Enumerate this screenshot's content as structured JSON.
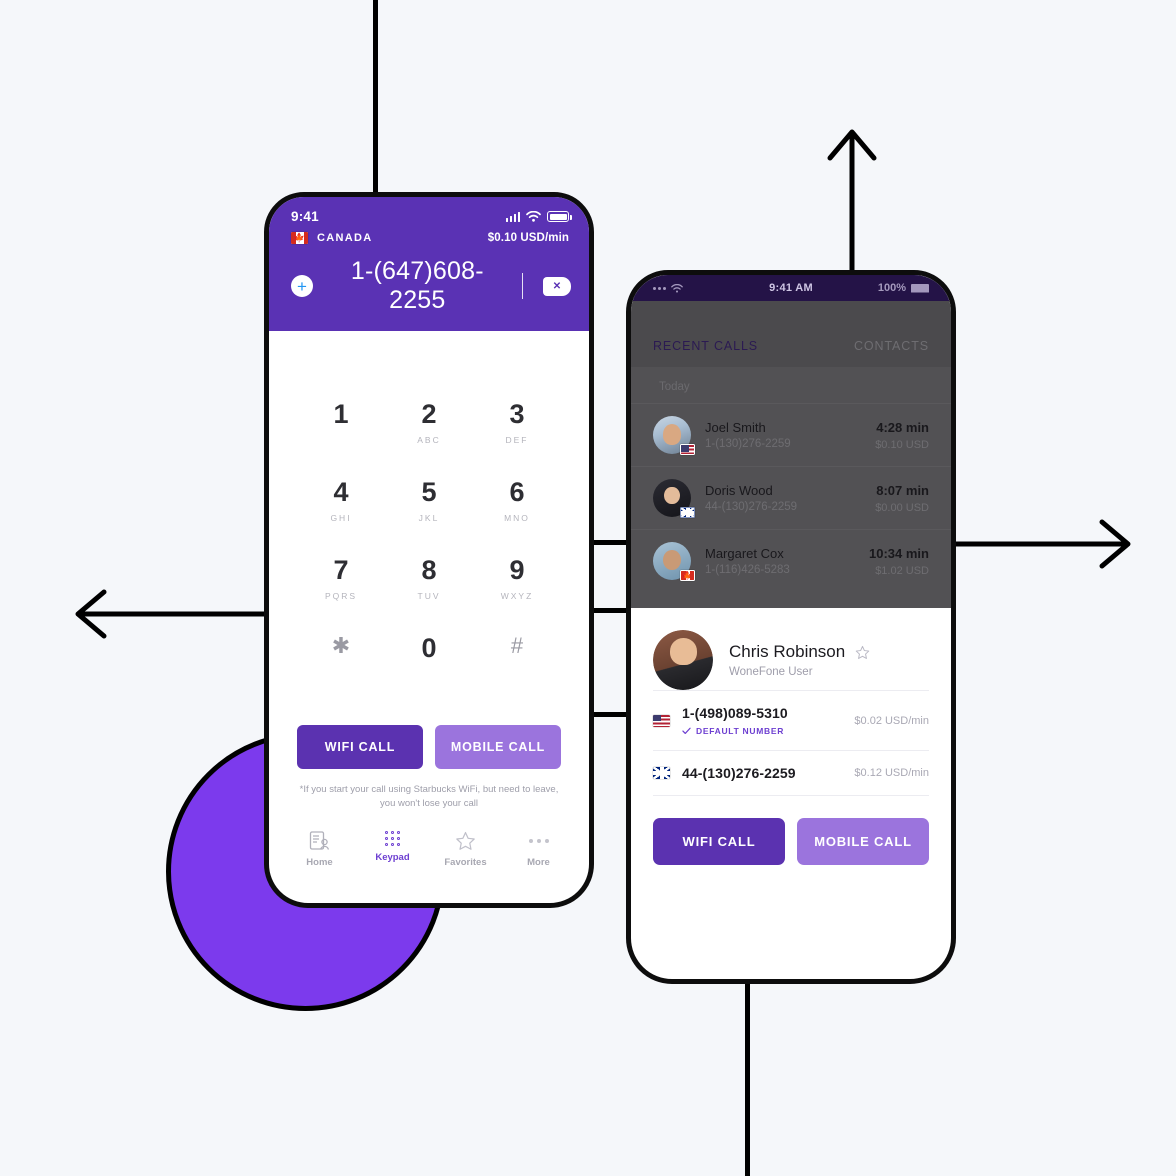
{
  "background_color": "#f5f7fa",
  "accent": {
    "primary": "#5a32b4",
    "secondary": "#9b74dd",
    "circle": "#7c3aed",
    "link": "#6d3fd1"
  },
  "phone1": {
    "status_bar": {
      "time": "9:41",
      "signal_icon": "signal-bars-icon",
      "wifi_icon": "wifi-icon",
      "battery_icon": "battery-icon"
    },
    "country_bar": {
      "flag_icon": "flag-canada-icon",
      "country": "CANADA",
      "rate": "$0.10 USD/min"
    },
    "dialer": {
      "add_icon": "plus-circle-icon",
      "number": "1-(647)608-2255",
      "delete_icon": "backspace-icon"
    },
    "keypad": [
      {
        "digit": "1",
        "letters": ""
      },
      {
        "digit": "2",
        "letters": "ABC"
      },
      {
        "digit": "3",
        "letters": "DEF"
      },
      {
        "digit": "4",
        "letters": "GHI"
      },
      {
        "digit": "5",
        "letters": "JKL"
      },
      {
        "digit": "6",
        "letters": "MNO"
      },
      {
        "digit": "7",
        "letters": "PQRS"
      },
      {
        "digit": "8",
        "letters": "TUV"
      },
      {
        "digit": "9",
        "letters": "WXYZ"
      },
      {
        "digit": "✱",
        "letters": ""
      },
      {
        "digit": "0",
        "letters": ""
      },
      {
        "digit": "#",
        "letters": ""
      }
    ],
    "wifi_call_label": "WIFI CALL",
    "mobile_call_label": "MOBILE CALL",
    "note": "*If you start your call using Starbucks WiFi, but need to leave, you won't lose your call",
    "tabs": [
      {
        "label": "Home",
        "icon": "contacts-list-icon",
        "active": false
      },
      {
        "label": "Keypad",
        "icon": "keypad-dots-icon",
        "active": true
      },
      {
        "label": "Favorites",
        "icon": "star-icon",
        "active": false
      },
      {
        "label": "More",
        "icon": "more-dots-icon",
        "active": false
      }
    ]
  },
  "phone2": {
    "status_bar": {
      "time": "9:41 AM",
      "battery": "100%",
      "signal_icon": "signal-dots-icon",
      "wifi_icon": "wifi-icon",
      "battery_icon": "battery-icon"
    },
    "tabs": {
      "recent": "RECENT CALLS",
      "contacts": "CONTACTS"
    },
    "section_label": "Today",
    "recent_calls": [
      {
        "name": "Joel Smith",
        "number": "1-(130)276-2259",
        "duration": "4:28 min",
        "cost": "$0.10 USD",
        "flag": "flag-us-icon",
        "avatar": "avatar-joel"
      },
      {
        "name": "Doris Wood",
        "number": "44-(130)276-2259",
        "duration": "8:07 min",
        "cost": "$0.00 USD",
        "flag": "flag-gb-icon",
        "avatar": "avatar-doris"
      },
      {
        "name": "Margaret Cox",
        "number": "1-(116)426-5283",
        "duration": "10:34 min",
        "cost": "$1.02 USD",
        "flag": "flag-ca-icon",
        "avatar": "avatar-margaret"
      }
    ],
    "contact": {
      "name": "Chris Robinson",
      "subtitle": "WoneFone User",
      "favorite_icon": "star-outline-icon",
      "avatar": "avatar-chris",
      "numbers": [
        {
          "number": "1-(498)089-5310",
          "rate": "$0.02 USD/min",
          "flag": "flag-us-icon",
          "default_label": "DEFAULT NUMBER",
          "is_default": true
        },
        {
          "number": "44-(130)276-2259",
          "rate": "$0.12 USD/min",
          "flag": "flag-gb-icon",
          "default_label": "",
          "is_default": false
        }
      ]
    },
    "wifi_call_label": "WIFI CALL",
    "mobile_call_label": "MOBILE CALL"
  }
}
